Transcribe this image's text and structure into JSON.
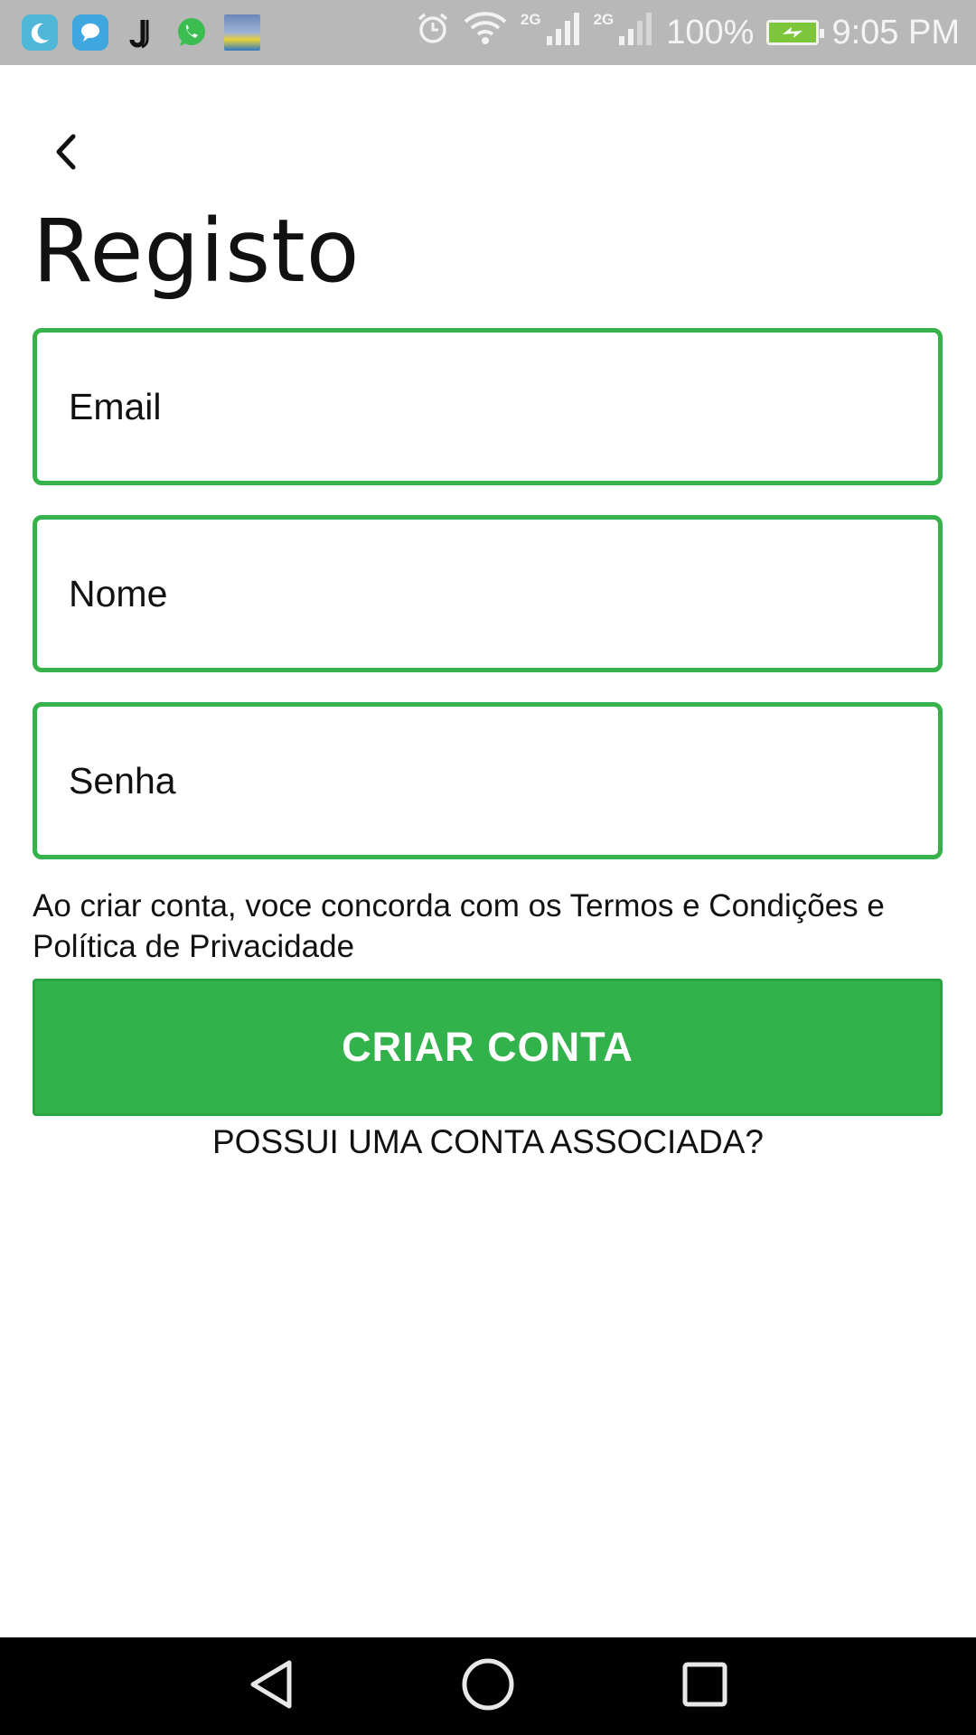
{
  "status_bar": {
    "notification_icons": [
      "moon-app-icon",
      "chat-bubble-icon",
      "juventus-icon",
      "whatsapp-icon",
      "landscape-app-icon"
    ],
    "network_label_1": "2G",
    "network_label_2": "2G",
    "battery_percent": "100%",
    "time": "9:05 PM",
    "colors": {
      "background": "#b8b8b8",
      "battery": "#7dc63b"
    }
  },
  "header": {
    "back_icon": "chevron-left-icon",
    "title": "Registo"
  },
  "form": {
    "email_placeholder": "Email",
    "name_placeholder": "Nome",
    "password_placeholder": "Senha",
    "field_border_color": "#35b34a"
  },
  "terms_text": "Ao criar conta, voce concorda com os Termos e Condições e Política de Privacidade",
  "create_button_label": "CRIAR CONTA",
  "login_link_label": "POSSUI UMA CONTA ASSOCIADA?",
  "accent_color": "#31b24a",
  "nav_bar": {
    "icons": [
      "back-triangle-icon",
      "home-circle-icon",
      "recents-square-icon"
    ]
  }
}
